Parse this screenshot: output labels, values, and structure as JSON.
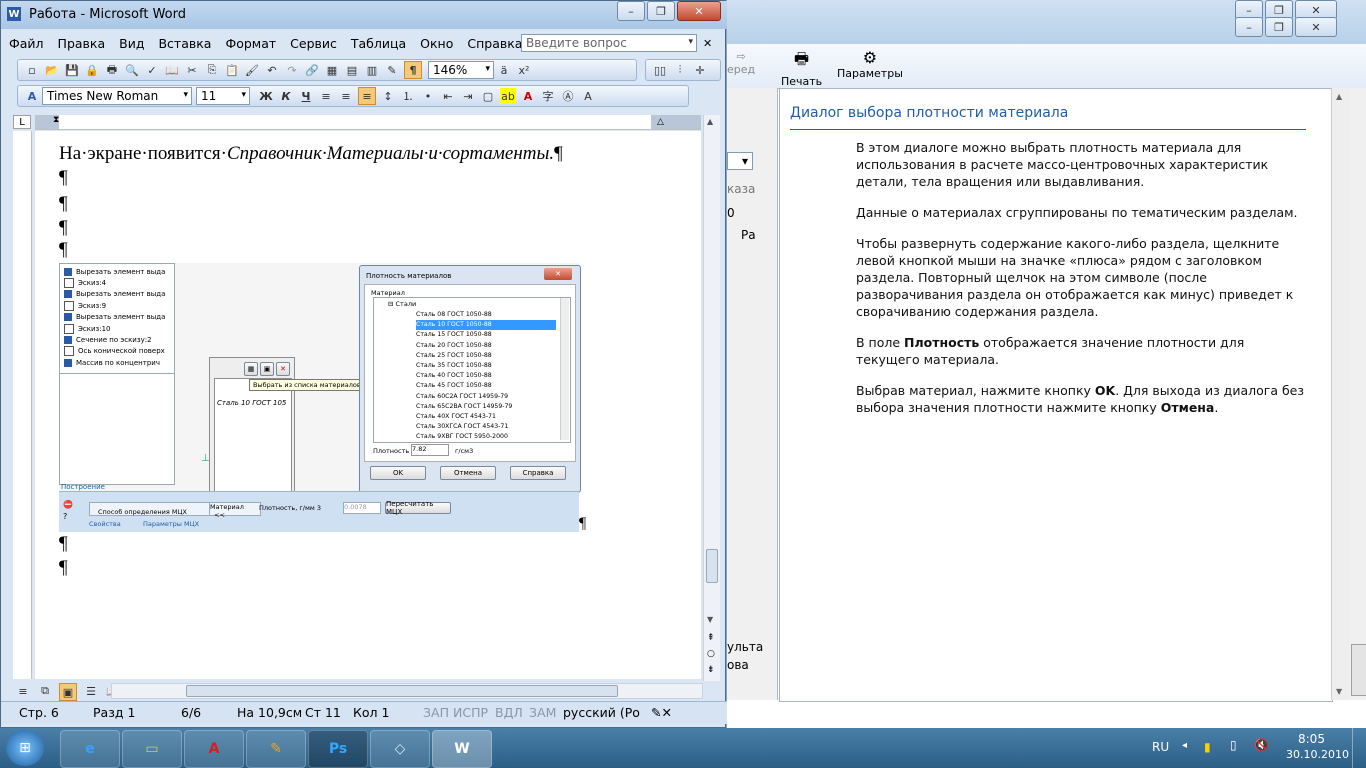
{
  "word": {
    "title": "Работа - Microsoft Word",
    "menu": [
      "Файл",
      "Правка",
      "Вид",
      "Вставка",
      "Формат",
      "Сервис",
      "Таблица",
      "Окно",
      "Справка"
    ],
    "menu_hotkeys": [
      "Ф",
      "П",
      "В",
      "с",
      "Ф",
      "С",
      "Т",
      "О",
      "С"
    ],
    "question_placeholder": "Введите вопрос",
    "zoom": "146%",
    "font_name": "Times New Roman",
    "font_size": "11",
    "bold": "Ж",
    "italic": "К",
    "underline": "Ч",
    "pilcrow": "¶",
    "ruler_marker": "L",
    "doc_line_plain": "На·экране·появится·",
    "doc_line_italic": "Справочник·Материалы·и·сортаменты.",
    "doc_line_end": "¶",
    "status": {
      "page": "Стр.  6",
      "section": "Разд  1",
      "pages": "6/6",
      "at": "На 10,9см",
      "line": "Ст  11",
      "col": "Кол  1",
      "rec": "ЗАП",
      "trk": "ИСПР",
      "ext": "ВДЛ",
      "ovr": "ЗАМ",
      "lang": "русский (Ро"
    }
  },
  "embedded": {
    "tree": [
      "Вырезать элемент выда",
      "Эскиз:4",
      "Вырезать элемент выда",
      "Эскиз:9",
      "Вырезать элемент выда",
      "Эскиз:10",
      "Сечение по эскизу:2",
      "Ось конической поверх",
      "Массив по концентрич"
    ],
    "tree_caption": "Построение",
    "tooltip": "Выбрать из списка материалов",
    "material_field": "Сталь 10  ГОСТ 105",
    "dialog_title": "Плотность материалов",
    "dialog_group": "Материал",
    "dialog_root": "Стали",
    "dialog_items": [
      "Сталь 08  ГОСТ 1050-88",
      "Сталь 10  ГОСТ 1050-88",
      "Сталь 15  ГОСТ 1050-88",
      "Сталь 20  ГОСТ 1050-88",
      "Сталь 25  ГОСТ 1050-88",
      "Сталь 35  ГОСТ 1050-88",
      "Сталь 40  ГОСТ 1050-88",
      "Сталь 45  ГОСТ 1050-88",
      "Сталь 60С2А  ГОСТ 14959-79",
      "Сталь 65С2ВА  ГОСТ 14959-79",
      "Сталь 40Х  ГОСТ 4543-71",
      "Сталь 30ХГСА  ГОСТ 4543-71",
      "Сталь 9ХВГ  ГОСТ 5950-2000"
    ],
    "density_label": "Плотность",
    "density_value": "7.82",
    "density_unit": "г/см3",
    "ok": "OK",
    "cancel": "Отмена",
    "help": "Справка",
    "bottom_method": "Способ определения МЦХ",
    "bottom_material": "Материал",
    "bottom_material_btn": "<<",
    "bottom_density": "Плотность, г/мм 3",
    "bottom_density_value": "0.0078",
    "bottom_recalc": "Пересчитать МЦХ",
    "tab_props": "Свойства",
    "tab_params": "Параметры МЦХ"
  },
  "help": {
    "back_label": "еред",
    "print_label": "Печать",
    "params_label": "Параметры",
    "left_fragments": [
      "каза",
      "0",
      "Ра",
      "ульта",
      "ова"
    ],
    "title": "Диалог выбора плотности материала",
    "p1": "В этом диалоге можно выбрать плотность материала для использования в расчете массо-центровочных характеристик детали, тела вращения или выдавливания.",
    "p2": "Данные о материалах сгруппированы по тематическим разделам.",
    "p3": "Чтобы развернуть содержание какого-либо раздела, щелкните левой кнопкой мыши на значке «плюса» рядом с заголовком раздела. Повторный щелчок на этом символе (после разворачивания раздела он отображается как минус) приведет к сворачиванию содержания раздела.",
    "p4_pre": "В поле ",
    "p4_bold": "Плотность",
    "p4_post": " отображается значение плотности для текущего материала.",
    "p5_pre": "Выбрав материал, нажмите кнопку ",
    "p5_b1": "OK",
    "p5_mid": ". Для выхода из диалога без выбора значения плотности нажмите кнопку ",
    "p5_b2": "Отмена",
    "p5_end": "."
  },
  "taskbar": {
    "lang": "RU",
    "time": "8:05",
    "date": "30.10.2010",
    "apps": [
      "internet-explorer",
      "explorer",
      "acrobat",
      "zone",
      "photoshop",
      "kompas",
      "word"
    ]
  },
  "colors": {
    "accent": "#1f5fa8",
    "selection": "#3399ff"
  }
}
